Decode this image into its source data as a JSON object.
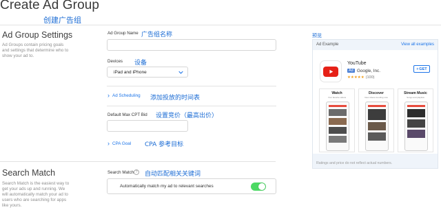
{
  "page": {
    "title": "Create Ad Group",
    "title_annotation": "创建广告组"
  },
  "settings": {
    "title": "Ad Group Settings",
    "description": "Ad Groups contain pricing goals and settings that determine who to show your ad to.",
    "ad_group_name": {
      "label": "Ad Group Name",
      "annotation": "广告组名称",
      "value": "",
      "placeholder": ""
    },
    "devices": {
      "label": "Devices",
      "annotation": "设备",
      "value": "iPad and iPhone"
    },
    "ad_scheduling": {
      "label": "Ad Scheduling",
      "annotation": "添加投放的时间表"
    },
    "max_cpt_bid": {
      "label": "Default Max CPT Bid",
      "annotation": "设置竞价（最高出价）",
      "value": ""
    },
    "cpa_goal": {
      "label": "CPA Goal",
      "annotation": "CPA 参考目标"
    }
  },
  "search_match": {
    "title": "Search Match",
    "description": "Search Match is the easiest way to get your ads up and running. We will automatically match your ad to users who are searching for apps like yours.",
    "field_label": "Search Match",
    "annotation": "自动匹配相关关键词",
    "toggle_text": "Automatically match my ad to relevant searches",
    "toggle_on": true,
    "toggle_color": "#4cd964"
  },
  "preview": {
    "annotation": "预览",
    "card_title": "Ad Example",
    "view_all": "View all examples",
    "app_name": "YouTube",
    "ad_badge": "Ad",
    "developer": "Google, Inc.",
    "stars": "★★★★★",
    "rating_count": "(100)",
    "get_label": "GET",
    "screenshots": [
      {
        "title": "Watch",
        "subtitle": "Your favorite videos"
      },
      {
        "title": "Discover",
        "subtitle": "New videos trending now"
      },
      {
        "title": "Stream Music",
        "subtitle": "Songs and playlists"
      }
    ],
    "footer": "Ratings and price do not reflect actual numbers."
  },
  "colors": {
    "accent": "#1a73e8",
    "annotation": "#1a6bd4",
    "youtube_red": "#e62117"
  }
}
